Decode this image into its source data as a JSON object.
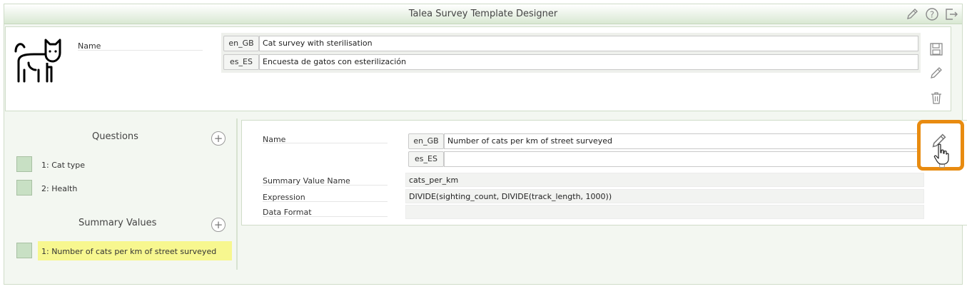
{
  "app": {
    "title": "Talea Survey Template Designer"
  },
  "titlebar_icons": [
    "pencil-icon",
    "help-icon",
    "logout-icon"
  ],
  "template": {
    "name_label": "Name",
    "names": [
      {
        "lang": "en_GB",
        "value": "Cat survey with sterilisation"
      },
      {
        "lang": "es_ES",
        "value": "Encuesta de gatos con esterilización"
      }
    ],
    "actions": [
      "save-icon",
      "edit-icon",
      "trash-icon"
    ]
  },
  "questions": {
    "title": "Questions",
    "add_symbol": "+",
    "items": [
      {
        "label": "1: Cat type"
      },
      {
        "label": "2: Health"
      }
    ]
  },
  "summary_values": {
    "title": "Summary Values",
    "add_symbol": "+",
    "items": [
      {
        "label": "1: Number of cats per km of street surveyed",
        "selected": true
      }
    ]
  },
  "detail": {
    "name_label": "Name",
    "names": [
      {
        "lang": "en_GB",
        "value": "Number of cats per km of street surveyed"
      },
      {
        "lang": "es_ES",
        "value": ""
      }
    ],
    "summary_value_name_label": "Summary Value Name",
    "summary_value_name": "cats_per_km",
    "expression_label": "Expression",
    "expression": "DIVIDE(sighting_count, DIVIDE(track_length, 1000))",
    "data_format_label": "Data Format",
    "data_format": ""
  },
  "colors": {
    "accent": "#e88b10",
    "swatch": "#c8e0c4",
    "highlight": "#f7f78f",
    "titlebar": "#d9e8d3"
  }
}
